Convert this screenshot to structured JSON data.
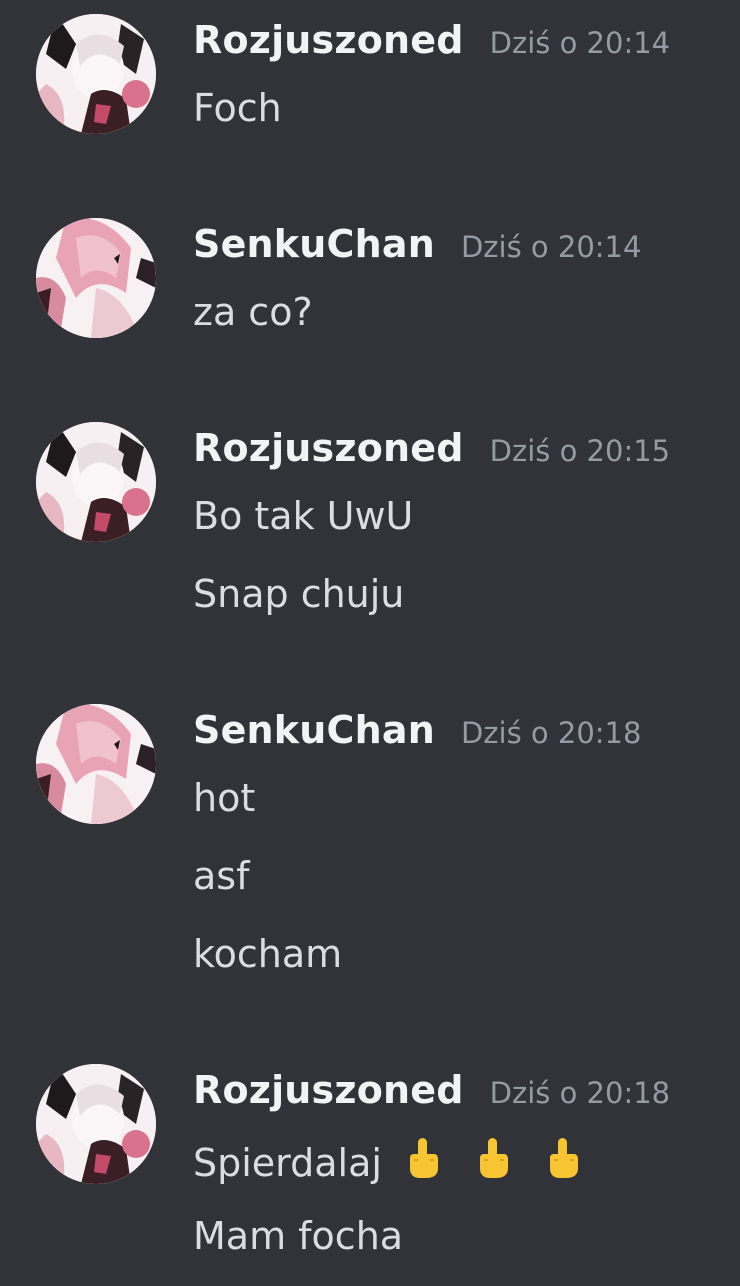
{
  "messages": [
    {
      "author": "Rozjuszoned",
      "timestamp": "Dziś o 20:14",
      "avatar_icon": "anime-avatar-rozjuszoned",
      "lines": [
        "Foch"
      ]
    },
    {
      "author": "SenkuChan",
      "timestamp": "Dziś o 20:14",
      "avatar_icon": "anime-avatar-senkuchan",
      "lines": [
        "za co?"
      ]
    },
    {
      "author": "Rozjuszoned",
      "timestamp": "Dziś o 20:15",
      "avatar_icon": "anime-avatar-rozjuszoned",
      "lines": [
        "Bo tak UwU",
        "Snap chuju"
      ]
    },
    {
      "author": "SenkuChan",
      "timestamp": "Dziś o 20:18",
      "avatar_icon": "anime-avatar-senkuchan",
      "lines": [
        "hot",
        "asf",
        "kocham"
      ]
    },
    {
      "author": "Rozjuszoned",
      "timestamp": "Dziś o 20:18",
      "avatar_icon": "anime-avatar-rozjuszoned",
      "lines": [
        "Spierdalaj",
        "Mam focha"
      ],
      "emoji": {
        "name": "middle-finger-emoji",
        "count": 3
      }
    }
  ],
  "colors": {
    "background": "#313338",
    "author": "#f2f3f5",
    "timestamp": "#949ba4",
    "message_text": "#dbdee1",
    "avatar_pink": "#e8a3b4",
    "emoji_yellow": "#f7c531"
  }
}
